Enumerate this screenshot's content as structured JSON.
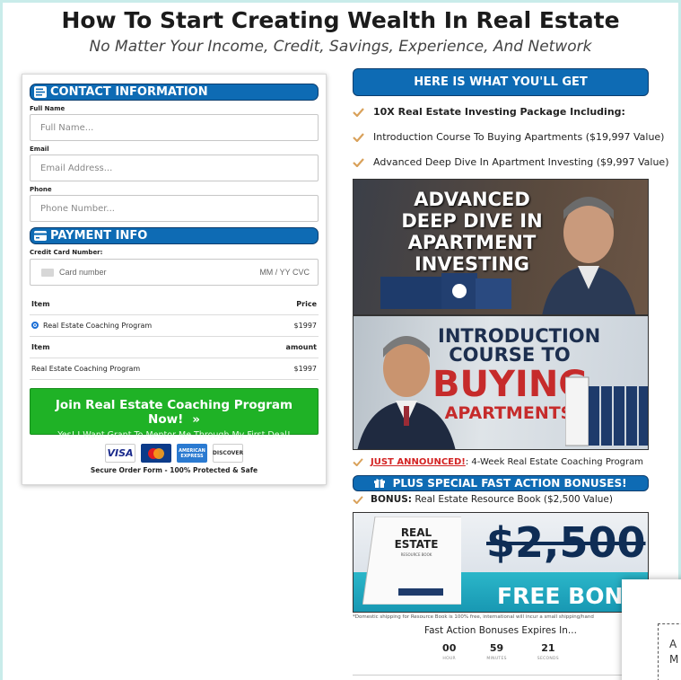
{
  "header": {
    "title": "How To Start Creating Wealth In Real Estate",
    "subtitle": "No Matter Your Income, Credit, Savings, Experience, And Network"
  },
  "form": {
    "contact_heading": "CONTACT INFORMATION",
    "full_name_label": "Full Name",
    "full_name_placeholder": "Full Name...",
    "email_label": "Email",
    "email_placeholder": "Email Address...",
    "phone_label": "Phone",
    "phone_placeholder": "Phone Number...",
    "payment_heading": "PAYMENT INFO",
    "card_label": "Credit Card Number:",
    "card_number_placeholder": "Card number",
    "card_exp_cvc": "MM / YY  CVC",
    "table1": {
      "col_item": "Item",
      "col_price": "Price",
      "row_item": "Real Estate Coaching Program",
      "row_price": "$1997"
    },
    "table2": {
      "col_item": "Item",
      "col_amount": "amount",
      "row_item": "Real Estate Coaching Program",
      "row_amount": "$1997"
    },
    "cta_main": "Join Real Estate Coaching Program Now!",
    "cta_chevron": "»",
    "cta_sub": "Yes! I Want Grant To Mentor Me Through My First Deal!",
    "payment_cards": [
      "VISA",
      "MasterCard",
      "AMERICAN EXPRESS",
      "DISCOVER"
    ],
    "secure_text": "Secure Order Form - 100% Protected & Safe"
  },
  "offer": {
    "heading": "HERE IS WHAT YOU'LL GET",
    "benefits": [
      "10X Real Estate Investing Package Including:",
      "Introduction Course To Buying Apartments ($19,997 Value)",
      "Advanced Deep Dive In Apartment Investing ($9,997 Value)"
    ],
    "promo1_title": "ADVANCED DEEP DIVE IN APARTMENT INVESTING",
    "promo2_title_a": "INTRODUCTION COURSE TO",
    "promo2_title_b": "BUYING",
    "promo2_title_c": "APARTMENTS",
    "announce_label": "JUST ANNOUNCED!",
    "announce_text": ": 4-Week Real Estate Coaching Program",
    "bonus_heading": "PLUS SPECIAL FAST ACTION BONUSES!",
    "bonus_label": "BONUS:",
    "bonus_text": " Real Estate Resource Book ($2,500 Value)",
    "book_title": "REAL ESTATE",
    "book_sub": "RESOURCE BOOK",
    "book_price": "$2,500",
    "book_free": "FREE BONUS",
    "ship_note": "*Domestic shipping for Resource Book is 100% free, international will incur a small shipping/hand",
    "expires_text": "Fast Action Bonuses Expires In...",
    "timer": [
      {
        "value": "00",
        "unit": "HOUR"
      },
      {
        "value": "59",
        "unit": "MINUTES"
      },
      {
        "value": "21",
        "unit": "SECONDS"
      }
    ]
  },
  "popup": {
    "line1": "A",
    "line2": "M"
  },
  "colors": {
    "accent": "#0e6bb4",
    "cta": "#1fb226",
    "check": "#d9a15a",
    "alert": "#d32424"
  }
}
